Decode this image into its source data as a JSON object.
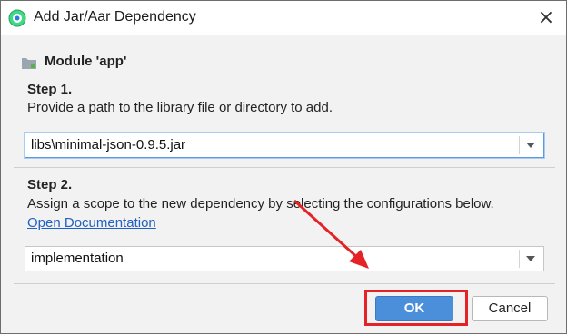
{
  "window": {
    "title": "Add Jar/Aar Dependency",
    "close_symbol": "×"
  },
  "module": {
    "label": "Module 'app'"
  },
  "step1": {
    "title": "Step 1.",
    "description": "Provide a path to the library file or directory to add.",
    "path_value": "libs\\minimal-json-0.9.5.jar"
  },
  "step2": {
    "title": "Step 2.",
    "description": "Assign a scope to the new dependency by selecting the configurations below.",
    "link": "Open Documentation",
    "scope_value": "implementation"
  },
  "buttons": {
    "ok": "OK",
    "cancel": "Cancel"
  },
  "colors": {
    "accent": "#4b8fdb",
    "annotation": "#e52226",
    "link": "#2160c4"
  }
}
